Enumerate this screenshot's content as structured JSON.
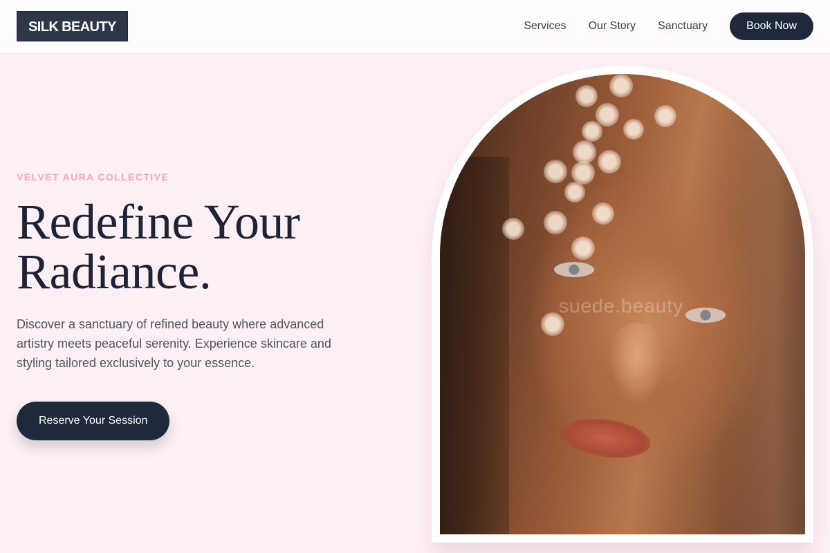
{
  "header": {
    "logo": "SILK BEAUTY",
    "nav": [
      {
        "label": "Services"
      },
      {
        "label": "Our Story"
      },
      {
        "label": "Sanctuary"
      }
    ],
    "book_label": "Book Now"
  },
  "hero": {
    "eyebrow": "VELVET AURA COLLECTIVE",
    "headline_line1": "Redefine Your",
    "headline_line2": "Radiance.",
    "description": "Discover a sanctuary of refined beauty where advanced artistry meets peaceful serenity. Experience skincare and styling tailored exclusively to your essence.",
    "cta_label": "Reserve Your Session",
    "image_watermark": "suede.beauty"
  },
  "colors": {
    "page_bg": "#fdf0f4",
    "header_bg": "#fefcfd",
    "primary_dark": "#1e293b",
    "accent_pink": "#f4a7bb",
    "headline": "#1e2235",
    "body_text": "#4b5563"
  }
}
